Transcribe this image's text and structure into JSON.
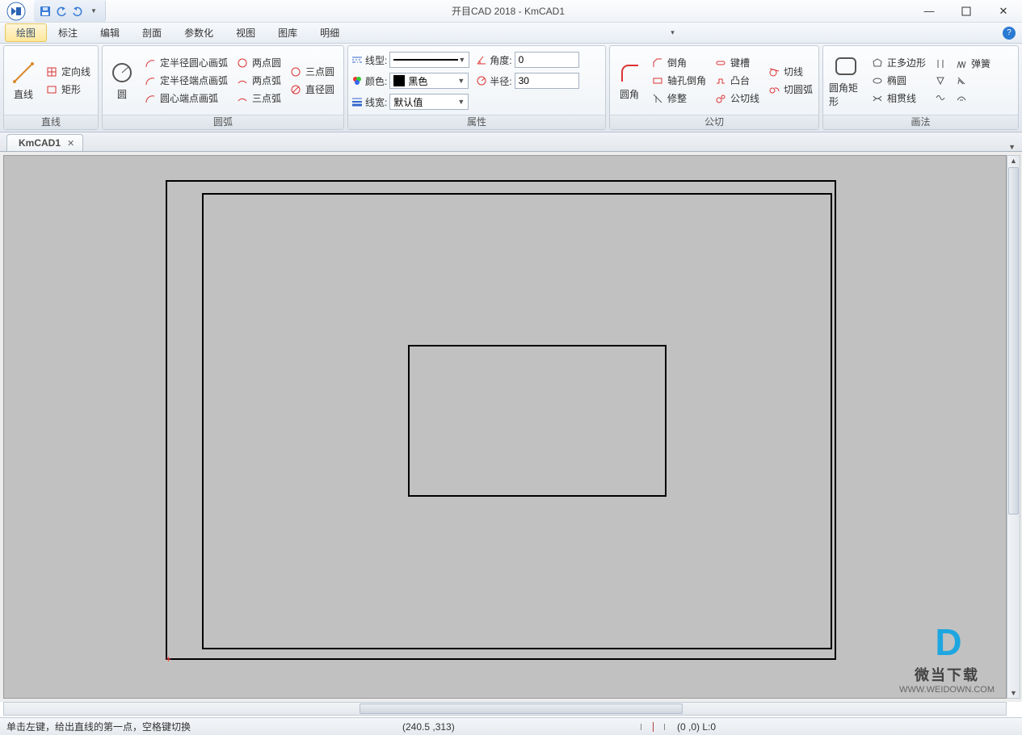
{
  "window": {
    "title": "开目CAD 2018 - KmCAD1"
  },
  "menu": {
    "items": [
      "绘图",
      "标注",
      "编辑",
      "剖面",
      "参数化",
      "视图",
      "图库",
      "明细"
    ],
    "active": "绘图"
  },
  "ribbon": {
    "p_line": {
      "label": "直线",
      "big": "直线",
      "opts": [
        "定向线",
        "矩形"
      ]
    },
    "p_arc": {
      "label": "圆弧",
      "big": "圆",
      "col1": [
        "定半径圆心画弧",
        "定半径端点画弧",
        "圆心端点画弧"
      ],
      "col2": [
        "两点圆",
        "两点弧",
        "三点弧"
      ],
      "col3": [
        "三点圆",
        "直径圆"
      ]
    },
    "p_attr": {
      "label": "属性",
      "linetype_lbl": "线型:",
      "linetype_val": "",
      "color_lbl": "颜色:",
      "color_val": "黑色",
      "linewidth_lbl": "线宽:",
      "linewidth_val": "默认值",
      "angle_lbl": "角度:",
      "angle_val": "0",
      "radius_lbl": "半径:",
      "radius_val": "30"
    },
    "p_tan": {
      "label": "公切",
      "big": "圆角",
      "r1": [
        "倒角",
        "键槽",
        "切线"
      ],
      "r2": [
        "轴孔倒角",
        "凸台",
        "切圆弧"
      ],
      "r3": [
        "修整",
        "公切线"
      ]
    },
    "p_draw": {
      "label": "画法",
      "big": "圆角矩形",
      "r1": [
        "正多边形",
        "弹簧"
      ],
      "r2": [
        "椭圆"
      ],
      "r3": [
        "相贯线"
      ],
      "iconsOnlyCol": [
        "a",
        "b",
        "c"
      ]
    }
  },
  "doc_tab": "KmCAD1",
  "status": {
    "hint": "单击左键，给出直线的第一点，空格键切换",
    "coord": "(240.5 ,313)",
    "origin": "(0 ,0) L:0"
  },
  "watermark": {
    "cn": "微当下载",
    "url": "WWW.WEIDOWN.COM"
  }
}
